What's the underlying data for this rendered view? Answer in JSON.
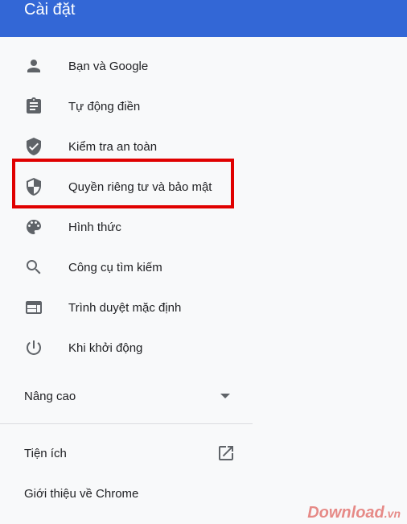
{
  "header": {
    "title": "Cài đặt"
  },
  "nav": [
    {
      "label": "Bạn và Google",
      "icon": "person-icon"
    },
    {
      "label": "Tự động điền",
      "icon": "clipboard-icon"
    },
    {
      "label": "Kiểm tra an toàn",
      "icon": "shield-check-icon"
    },
    {
      "label": "Quyền riêng tư và bảo mật",
      "icon": "security-shield-icon",
      "highlighted": true
    },
    {
      "label": "Hình thức",
      "icon": "palette-icon"
    },
    {
      "label": "Công cụ tìm kiếm",
      "icon": "search-icon"
    },
    {
      "label": "Trình duyệt mặc định",
      "icon": "browser-window-icon"
    },
    {
      "label": "Khi khởi động",
      "icon": "power-icon"
    }
  ],
  "advanced": {
    "label": "Nâng cao",
    "icon": "dropdown-arrow-icon"
  },
  "bottom": [
    {
      "label": "Tiện ích",
      "icon": "open-in-new-icon"
    },
    {
      "label": "Giới thiệu về Chrome"
    }
  ],
  "watermark": {
    "text": "Download",
    "suffix": ".vn"
  },
  "colors": {
    "header": "#3367d6",
    "highlight": "#e00000",
    "icon": "#5f6368"
  }
}
